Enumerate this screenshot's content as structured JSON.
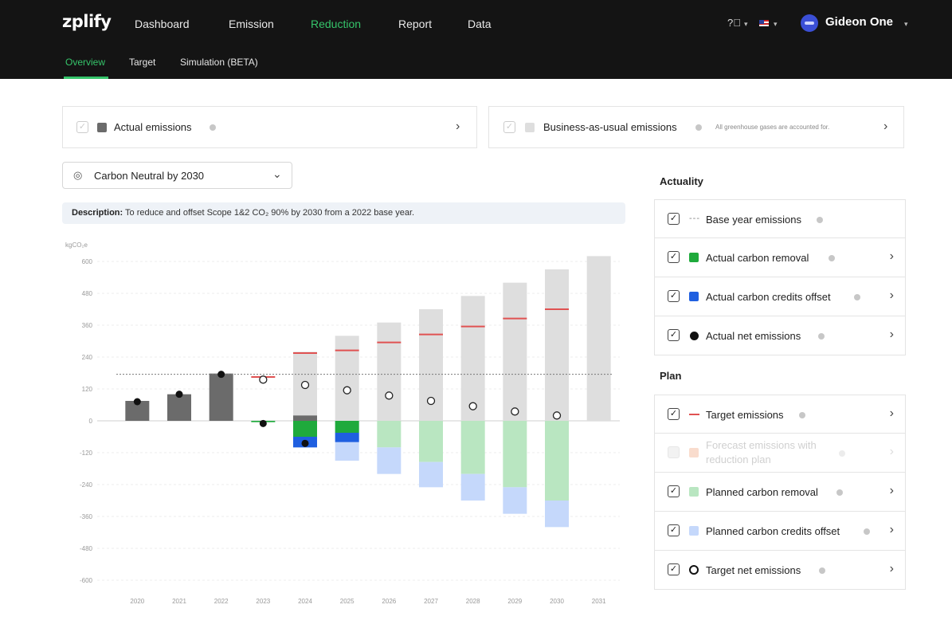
{
  "header": {
    "logo": "zplify",
    "nav": [
      "Dashboard",
      "Emission",
      "Reduction",
      "Report",
      "Data"
    ],
    "active_nav": "Reduction",
    "subnav": [
      "Overview",
      "Target",
      "Simulation (BETA)"
    ],
    "active_subnav": "Overview",
    "user_name": "Gideon One"
  },
  "top_cards": {
    "actual_label": "Actual emissions",
    "bau_label": "Business-as-usual emissions",
    "bau_note": "All greenhouse gases are accounted for."
  },
  "target_select": {
    "value": "Carbon Neutral by 2030"
  },
  "description": {
    "prefix": "Description:",
    "text": "To reduce and offset Scope 1&2 CO₂ 90% by 2030 from a 2022 base year."
  },
  "legend": {
    "actuality_title": "Actuality",
    "plan_title": "Plan",
    "actuality": [
      {
        "label": "Base year emissions",
        "color": "#888888",
        "marker": "dashed-line",
        "checked": true
      },
      {
        "label": "Actual carbon removal",
        "color": "#1faa3c",
        "marker": "square",
        "checked": true
      },
      {
        "label": "Actual carbon credits offset",
        "color": "#1f5fe0",
        "marker": "square",
        "checked": true
      },
      {
        "label": "Actual net emissions",
        "color": "#111111",
        "marker": "dot",
        "checked": true
      }
    ],
    "plan": [
      {
        "label": "Target emissions",
        "color": "#e05252",
        "marker": "line",
        "checked": true
      },
      {
        "label": "Forecast emissions with reduction plan",
        "color": "#f4b89a",
        "marker": "square",
        "checked": false
      },
      {
        "label": "Planned carbon removal",
        "color": "#b9e6c1",
        "marker": "square",
        "checked": true
      },
      {
        "label": "Planned carbon credits offset",
        "color": "#c5d8fb",
        "marker": "square",
        "checked": true
      },
      {
        "label": "Target net emissions",
        "color": "#111111",
        "marker": "ring",
        "checked": true
      }
    ]
  },
  "colors": {
    "accent": "#35c46a",
    "actual_emissions": "#6b6b6b",
    "bau": "#dedede",
    "actual_removal": "#1faa3c",
    "actual_offset": "#1f5fe0",
    "planned_removal": "#b9e6c1",
    "planned_offset": "#c5d8fb",
    "target": "#e05252"
  },
  "chart_data": {
    "type": "bar",
    "ylabel": "kgCO₂e",
    "ylim": [
      -600,
      600
    ],
    "yticks": [
      600,
      480,
      360,
      240,
      120,
      0,
      -120,
      -240,
      -360,
      -480,
      -600
    ],
    "ytick_labels": [
      "600",
      "480",
      "360",
      "240",
      "120",
      "0",
      "-120",
      "-240",
      "-360",
      "-480",
      "-600"
    ],
    "categories": [
      "2020",
      "2021",
      "2022",
      "2023",
      "2024",
      "2025",
      "2026",
      "2027",
      "2028",
      "2029",
      "2030",
      "2031"
    ],
    "base_year_value": 175,
    "series": [
      {
        "name": "Actual emissions",
        "values": [
          75,
          100,
          178,
          null,
          20,
          null,
          null,
          null,
          null,
          null,
          null,
          null
        ]
      },
      {
        "name": "Business-as-usual emissions",
        "values": [
          null,
          null,
          null,
          null,
          260,
          320,
          370,
          420,
          470,
          520,
          570,
          620
        ]
      },
      {
        "name": "Actual carbon removal",
        "values": [
          null,
          null,
          null,
          -5,
          -60,
          -45,
          null,
          null,
          null,
          null,
          null,
          null
        ]
      },
      {
        "name": "Actual carbon credits offset",
        "values": [
          null,
          null,
          null,
          null,
          -40,
          -35,
          null,
          null,
          null,
          null,
          null,
          null
        ]
      },
      {
        "name": "Actual net emissions",
        "values": [
          72,
          100,
          175,
          -10,
          -85,
          null,
          null,
          null,
          null,
          null,
          null,
          null
        ]
      },
      {
        "name": "Target emissions",
        "values": [
          null,
          null,
          null,
          165,
          255,
          265,
          295,
          325,
          355,
          385,
          420,
          null
        ]
      },
      {
        "name": "Planned carbon removal",
        "values": [
          null,
          null,
          null,
          null,
          null,
          null,
          -100,
          -155,
          -200,
          -250,
          -300,
          null
        ]
      },
      {
        "name": "Planned carbon credits offset",
        "values": [
          null,
          null,
          null,
          null,
          -100,
          -150,
          -200,
          -250,
          -300,
          -350,
          -400,
          null
        ]
      },
      {
        "name": "Target net emissions",
        "values": [
          null,
          null,
          null,
          155,
          135,
          115,
          95,
          75,
          55,
          35,
          20,
          null
        ]
      }
    ]
  }
}
